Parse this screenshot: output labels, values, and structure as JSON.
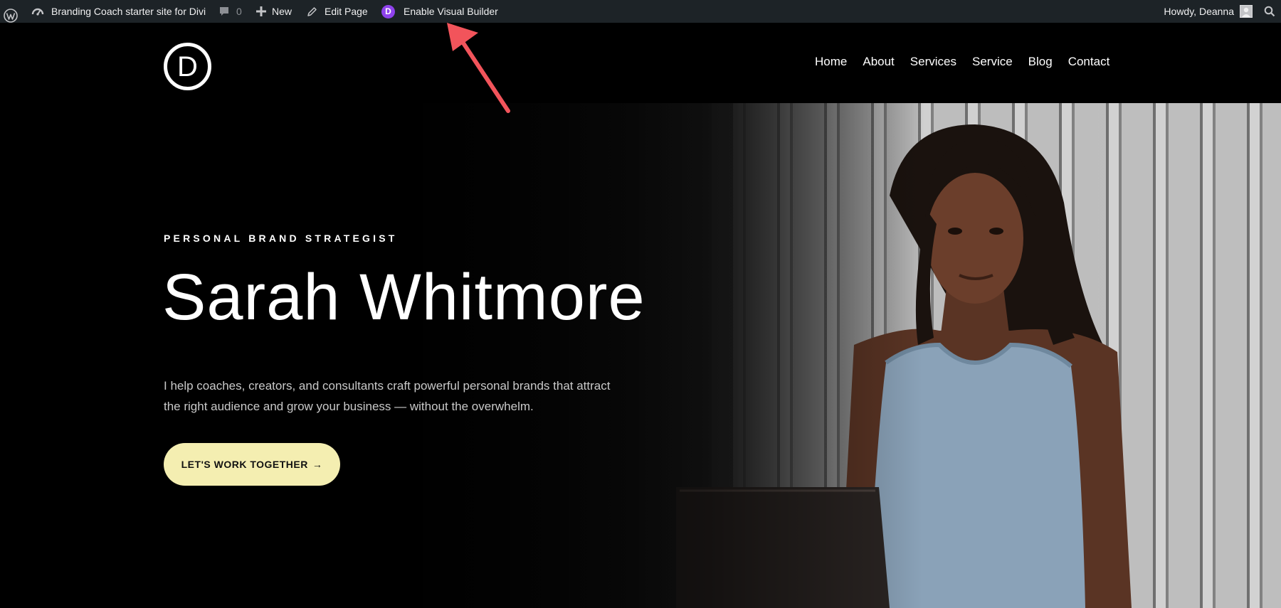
{
  "adminbar": {
    "site_name": "Branding Coach starter site for Divi",
    "comments_count": "0",
    "new_label": "New",
    "edit_label": "Edit Page",
    "divi_badge": "D",
    "visual_builder_label": "Enable Visual Builder",
    "howdy_label": "Howdy, Deanna",
    "icons": {
      "wp": "wordpress-logo-icon",
      "site": "dashboard-icon",
      "comments": "comment-icon",
      "new": "plus-icon",
      "edit": "pencil-icon",
      "search": "search-icon"
    },
    "colors": {
      "bg": "#1d2327",
      "divi_purple": "#8f42ec"
    }
  },
  "header": {
    "logo_letter": "D",
    "nav": [
      {
        "label": "Home"
      },
      {
        "label": "About"
      },
      {
        "label": "Services"
      },
      {
        "label": "Service"
      },
      {
        "label": "Blog"
      },
      {
        "label": "Contact"
      }
    ]
  },
  "hero": {
    "eyebrow": "PERSONAL BRAND STRATEGIST",
    "headline": "Sarah Whitmore",
    "intro": "I help coaches, creators, and consultants craft powerful personal brands that attract the right audience and grow your business — without the overwhelm.",
    "cta_label": "LET'S WORK TOGETHER",
    "cta_arrow": "→",
    "colors": {
      "cta_bg": "#f4eeb1",
      "annotation_arrow": "#f2545b"
    }
  }
}
